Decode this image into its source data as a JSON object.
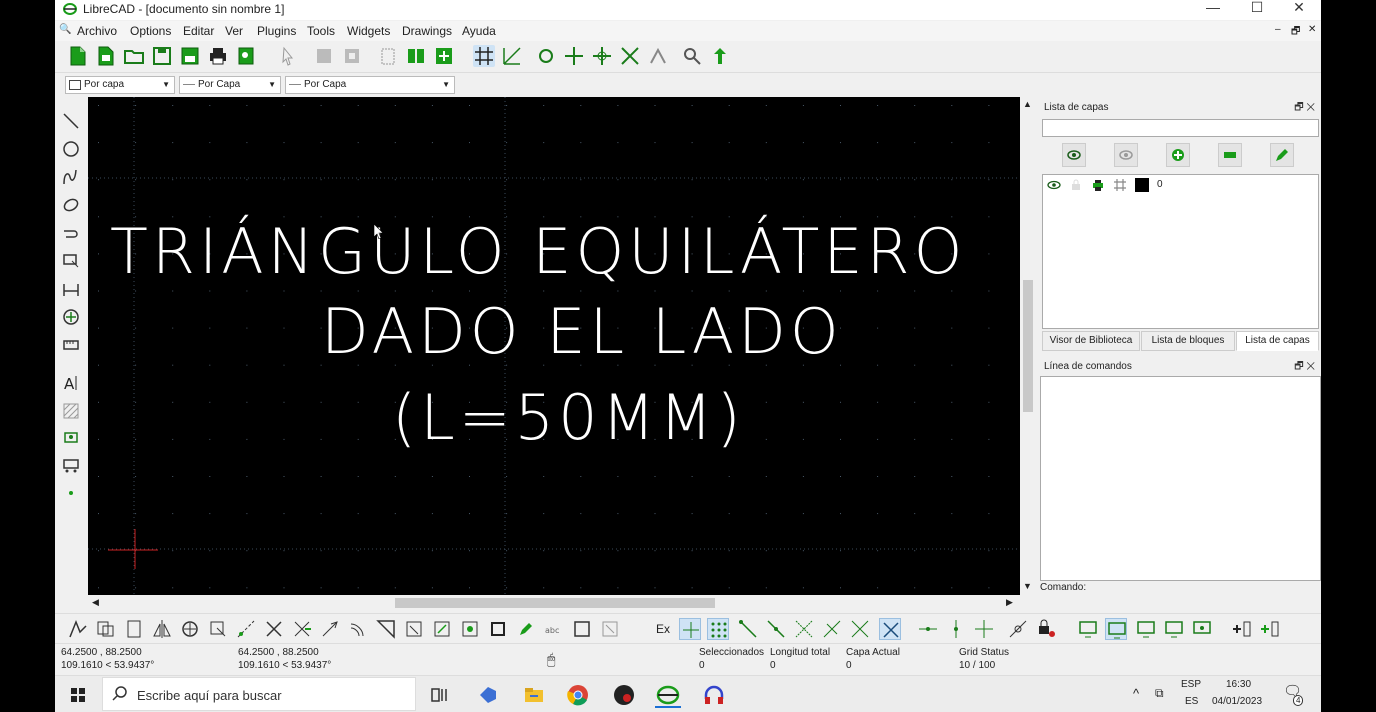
{
  "window": {
    "title": "LibreCAD - [documento sin nombre 1]",
    "minimize": "—",
    "maximize": "☐",
    "close": "✕"
  },
  "menu": [
    "Archivo",
    "Options",
    "Editar",
    "Ver",
    "Plugins",
    "Tools",
    "Widgets",
    "Drawings",
    "Ayuda"
  ],
  "mdi_controls": [
    "–",
    "🗗",
    "✕"
  ],
  "pen_toolbar": {
    "color": "Por capa",
    "width": "Por Capa",
    "linetype": "Por Capa"
  },
  "canvas": {
    "text_lines": [
      "TRIÁNGULO  EQUILÁTERO",
      "DADO EL LADO",
      "(L=50MM)"
    ],
    "background": "#000000",
    "grid_color": "#3a4a5a",
    "crosshair_color": "#cc2222"
  },
  "layers_panel": {
    "title": "Lista de capas",
    "filter_value": "",
    "layers": [
      {
        "name": "0",
        "color": "#000000"
      }
    ]
  },
  "dock_tabs": [
    "Visor de Biblioteca",
    "Lista de bloques",
    "Lista de capas"
  ],
  "active_dock_tab": "Lista de capas",
  "command_panel": {
    "title": "Línea de comandos",
    "prompt_label": "Comando:"
  },
  "status": {
    "coord_abs_1": "64.2500 , 88.2500",
    "coord_abs_2": "109.1610 < 53.9437°",
    "coord_rel_1": "64.2500 , 88.2500",
    "coord_rel_2": "109.1610 < 53.9437°",
    "selected_label": "Seleccionados",
    "selected_value": "0",
    "total_length_label": "Longitud total",
    "total_length_value": "0",
    "current_layer_label": "Capa Actual",
    "current_layer_value": "0",
    "grid_status_label": "Grid Status",
    "grid_status_value": "10 / 100"
  },
  "snap_toolbar": {
    "ex_label": "Ex"
  },
  "taskbar": {
    "search_placeholder": "Escribe aquí para buscar",
    "lang_top": "ESP",
    "lang_bottom": "ES",
    "time": "16:30",
    "date": "04/01/2023",
    "notifications": "4"
  },
  "colors": {
    "accent": "#1a9c1a",
    "snap_active_bg": "#cfe3f5"
  }
}
